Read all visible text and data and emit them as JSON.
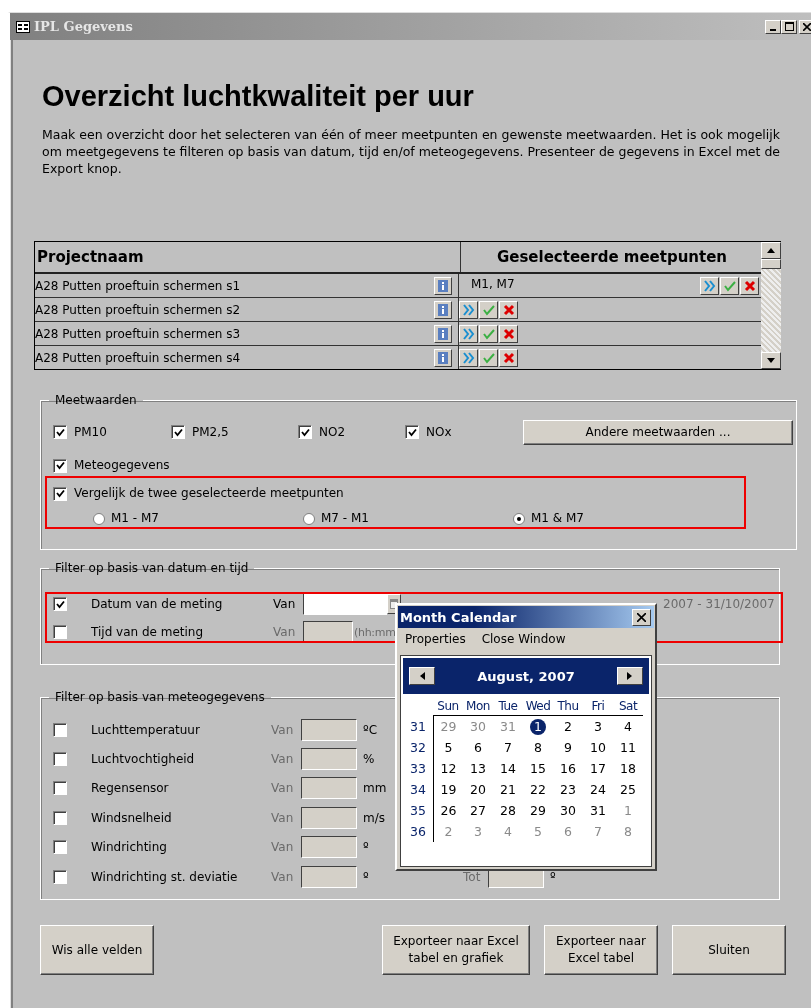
{
  "window": {
    "title": "IPL Gegevens"
  },
  "heading": "Overzicht luchtkwaliteit per uur",
  "description": "Maak een overzicht door het selecteren van één of meer meetpunten en gewenste meetwaarden. Het is ook mogelijk om meetgegevens te filteren op basis van datum, tijd en/of meteogegevens. Presenteer de gegevens in Excel met de Export knop.",
  "projects": {
    "columns": [
      "Projectnaam",
      "Geselecteerde meetpunten"
    ],
    "rows": [
      {
        "name": "A28 Putten proeftuin schermen s1",
        "points": "M1, M7"
      },
      {
        "name": "A28 Putten proeftuin schermen s2",
        "points": ""
      },
      {
        "name": "A28 Putten proeftuin schermen s3",
        "points": ""
      },
      {
        "name": "A28 Putten proeftuin schermen s4",
        "points": ""
      }
    ]
  },
  "meetwaarden": {
    "legend": "Meetwaarden",
    "checks": [
      {
        "label": "PM10",
        "checked": true
      },
      {
        "label": "PM2,5",
        "checked": true
      },
      {
        "label": "NO2",
        "checked": true
      },
      {
        "label": "NOx",
        "checked": true
      }
    ],
    "button": "Andere meetwaarden ...",
    "meteo": {
      "label": "Meteogegevens",
      "checked": true
    },
    "compare": {
      "label": "Vergelijk de twee geselecteerde meetpunten",
      "checked": true
    },
    "options": [
      {
        "label": "M1 - M7",
        "selected": false
      },
      {
        "label": "M7 - M1",
        "selected": false
      },
      {
        "label": "M1 & M7",
        "selected": true
      }
    ]
  },
  "date_filter": {
    "legend": "Filter op basis van datum en tijd",
    "rows": [
      {
        "label": "Datum van de meting",
        "checked": true,
        "disabled": false,
        "from": "Van",
        "hint": "2007 - 31/10/2007"
      },
      {
        "label": "Tijd van de meting",
        "checked": false,
        "disabled": true,
        "from": "Van",
        "hint": "(hh:mm"
      }
    ]
  },
  "meteo_filter": {
    "legend": "Filter op basis van meteogegevens",
    "rows": [
      {
        "label": "Luchttemperatuur",
        "checked": false,
        "from": "Van",
        "unit": "ºC"
      },
      {
        "label": "Luchtvochtigheid",
        "checked": false,
        "from": "Van",
        "unit": "%"
      },
      {
        "label": "Regensensor",
        "checked": false,
        "from": "Van",
        "unit": "mm"
      },
      {
        "label": "Windsnelheid",
        "checked": false,
        "from": "Van",
        "unit": "m/s"
      },
      {
        "label": "Windrichting",
        "checked": false,
        "from": "Van",
        "unit": "º"
      },
      {
        "label": "Windrichting st. deviatie",
        "checked": false,
        "from": "Van",
        "unit": "º",
        "to": "Tot",
        "to_unit": "º"
      }
    ]
  },
  "buttons": [
    "Wis alle velden",
    "Exporteer naar Excel tabel en grafiek",
    "Exporteer naar Excel tabel",
    "Sluiten"
  ],
  "calendar": {
    "title": "Month Calendar",
    "menu": [
      "Properties",
      "Close Window"
    ],
    "month": "August, 2007",
    "weekdays": [
      "Sun",
      "Mon",
      "Tue",
      "Wed",
      "Thu",
      "Fri",
      "Sat"
    ],
    "weeks": [
      {
        "number": "31",
        "days": [
          {
            "day": "29",
            "other": true,
            "selected": false
          },
          {
            "day": "30",
            "other": true,
            "selected": false
          },
          {
            "day": "31",
            "other": true,
            "selected": false
          },
          {
            "day": "1",
            "other": false,
            "selected": true
          },
          {
            "day": "2",
            "other": false,
            "selected": false
          },
          {
            "day": "3",
            "other": false,
            "selected": false
          },
          {
            "day": "4",
            "other": false,
            "selected": false
          }
        ]
      },
      {
        "number": "32",
        "days": [
          {
            "day": "5",
            "other": false,
            "selected": false
          },
          {
            "day": "6",
            "other": false,
            "selected": false
          },
          {
            "day": "7",
            "other": false,
            "selected": false
          },
          {
            "day": "8",
            "other": false,
            "selected": false
          },
          {
            "day": "9",
            "other": false,
            "selected": false
          },
          {
            "day": "10",
            "other": false,
            "selected": false
          },
          {
            "day": "11",
            "other": false,
            "selected": false
          }
        ]
      },
      {
        "number": "33",
        "days": [
          {
            "day": "12",
            "other": false,
            "selected": false
          },
          {
            "day": "13",
            "other": false,
            "selected": false
          },
          {
            "day": "14",
            "other": false,
            "selected": false
          },
          {
            "day": "15",
            "other": false,
            "selected": false
          },
          {
            "day": "16",
            "other": false,
            "selected": false
          },
          {
            "day": "17",
            "other": false,
            "selected": false
          },
          {
            "day": "18",
            "other": false,
            "selected": false
          }
        ]
      },
      {
        "number": "34",
        "days": [
          {
            "day": "19",
            "other": false,
            "selected": false
          },
          {
            "day": "20",
            "other": false,
            "selected": false
          },
          {
            "day": "21",
            "other": false,
            "selected": false
          },
          {
            "day": "22",
            "other": false,
            "selected": false
          },
          {
            "day": "23",
            "other": false,
            "selected": false
          },
          {
            "day": "24",
            "other": false,
            "selected": false
          },
          {
            "day": "25",
            "other": false,
            "selected": false
          }
        ]
      },
      {
        "number": "35",
        "days": [
          {
            "day": "26",
            "other": false,
            "selected": false
          },
          {
            "day": "27",
            "other": false,
            "selected": false
          },
          {
            "day": "28",
            "other": false,
            "selected": false
          },
          {
            "day": "29",
            "other": false,
            "selected": false
          },
          {
            "day": "30",
            "other": false,
            "selected": false
          },
          {
            "day": "31",
            "other": false,
            "selected": false
          },
          {
            "day": "1",
            "other": true,
            "selected": false
          }
        ]
      },
      {
        "number": "36",
        "days": [
          {
            "day": "2",
            "other": true,
            "selected": false
          },
          {
            "day": "3",
            "other": true,
            "selected": false
          },
          {
            "day": "4",
            "other": true,
            "selected": false
          },
          {
            "day": "5",
            "other": true,
            "selected": false
          },
          {
            "day": "6",
            "other": true,
            "selected": false
          },
          {
            "day": "7",
            "other": true,
            "selected": false
          },
          {
            "day": "8",
            "other": true,
            "selected": false
          }
        ]
      }
    ]
  }
}
